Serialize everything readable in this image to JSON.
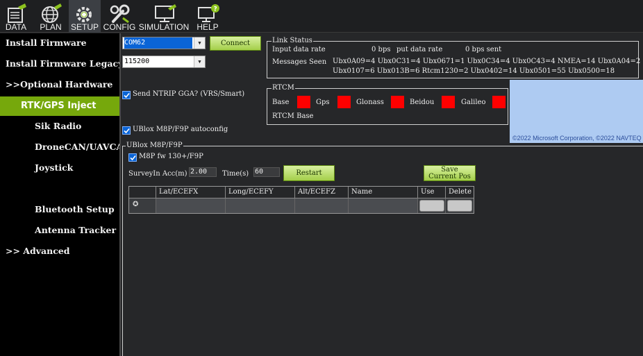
{
  "toolbar": {
    "items": [
      {
        "label": "DATA",
        "icon": "data-icon"
      },
      {
        "label": "PLAN",
        "icon": "plan-icon"
      },
      {
        "label": "SETUP",
        "icon": "setup-icon"
      },
      {
        "label": "CONFIG",
        "icon": "config-icon"
      },
      {
        "label": "SIMULATION",
        "icon": "simulation-icon"
      },
      {
        "label": "HELP",
        "icon": "help-icon"
      }
    ],
    "active": "SETUP"
  },
  "sidebar": {
    "items": [
      {
        "label": "Install Firmware"
      },
      {
        "label": "Install Firmware Legacy"
      },
      {
        "label": ">>Optional Hardware"
      },
      {
        "label": "RTK/GPS Inject"
      },
      {
        "label": "Sik Radio"
      },
      {
        "label": "DroneCAN/UAVCAN"
      },
      {
        "label": "Joystick"
      },
      {
        "label": "Bluetooth Setup"
      },
      {
        "label": "Antenna Tracker"
      },
      {
        "label": ">> Advanced"
      }
    ]
  },
  "connection": {
    "port": "COM62",
    "baud": "115200",
    "connect_label": "Connect"
  },
  "link_status": {
    "title": "Link Status",
    "input_label": "Input data rate",
    "input_value": "0 bps",
    "output_label": "put data rate",
    "output_value": "0 bps sent",
    "messages_label": "Messages Seen",
    "messages_line1": "Ubx0A09=4 Ubx0C31=4 Ubx0671=1 Ubx0C34=4 Ubx0C43=4 NMEA=14 Ubx0A04=2",
    "messages_line2": "Ubx0107=6 Ubx013B=6 Rtcm1230=2 Ubx0402=14 Ubx0501=55 Ubx0500=18"
  },
  "ntrip": {
    "label": "Send NTRIP GGA? (VRS/Smart)",
    "checked": true
  },
  "rtcm": {
    "title": "RTCM",
    "base": "Base",
    "gps": "Gps",
    "glonass": "Glonass",
    "beidou": "Beidou",
    "galileo": "Galileo",
    "rtcm_base": "RTCM Base",
    "indicator_color": "#ff0000"
  },
  "map": {
    "credit": "©2022 Microsoft Corporation, ©2022 NAVTEQ"
  },
  "ublox_auto": {
    "label": "UBlox M8P/F9P autoconfig",
    "checked": true
  },
  "ublox_group": {
    "title": "UBlox M8P/F9P",
    "fw_label": "M8P fw 130+/F9P",
    "fw_checked": true,
    "survey_label": "SurveyIn Acc(m)",
    "survey_value": "2.00",
    "time_label": "Time(s)",
    "time_value": "60",
    "restart_label": "Restart",
    "save_label_1": "Save",
    "save_label_2": "Current Pos"
  },
  "grid": {
    "columns": [
      "Lat/ECEFX",
      "Long/ECEFY",
      "Alt/ECEFZ",
      "Name",
      "Use",
      "Delete"
    ],
    "row_marker": "✪"
  }
}
